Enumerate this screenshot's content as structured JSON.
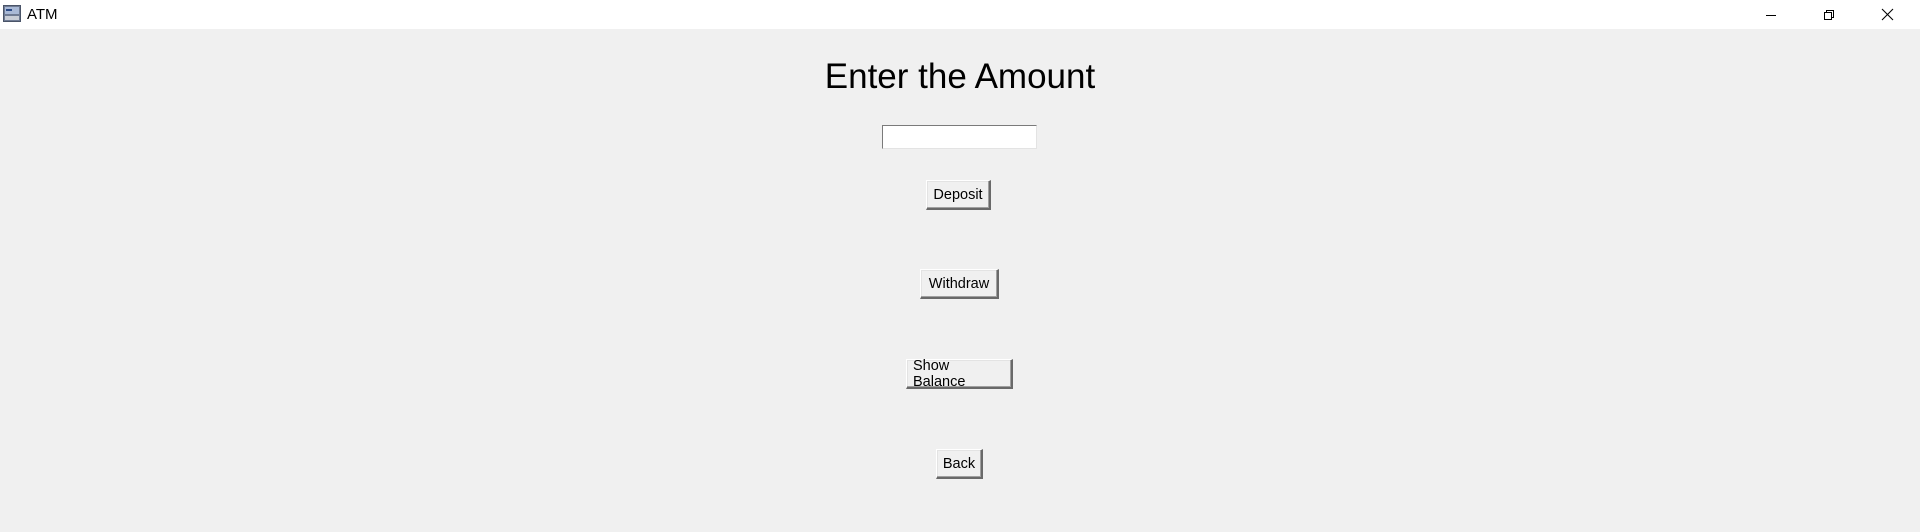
{
  "window": {
    "title": "ATM",
    "app_icon": "tk-feather-icon",
    "controls": {
      "minimize_icon": "minimize-icon",
      "restore_icon": "restore-icon",
      "close_icon": "close-icon"
    }
  },
  "main": {
    "heading": "Enter the Amount",
    "amount_input": {
      "value": "",
      "placeholder": ""
    },
    "buttons": {
      "deposit": "Deposit",
      "withdraw": "Withdraw",
      "show_balance": "Show Balance",
      "back": "Back"
    }
  },
  "colors": {
    "background": "#f0f0f0",
    "titlebar": "#ffffff"
  }
}
